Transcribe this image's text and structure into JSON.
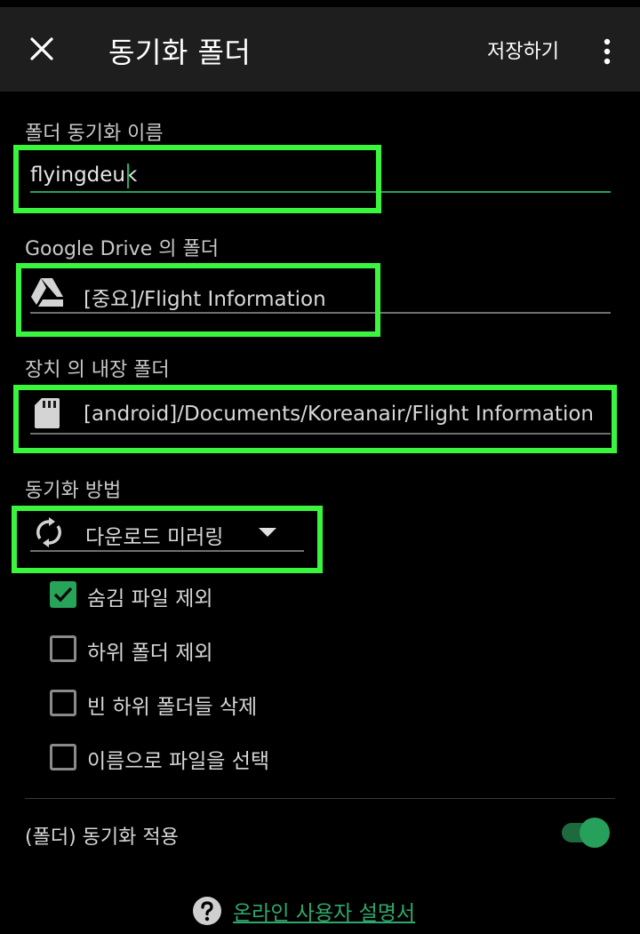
{
  "header": {
    "title": "동기화 폴더",
    "save_label": "저장하기",
    "close_icon": "close-icon",
    "more_icon": "more-vertical-icon"
  },
  "sync_name": {
    "label": "폴더 동기화 이름",
    "value": "flyingdeuk"
  },
  "remote_folder": {
    "label": "Google Drive 의 폴더",
    "value": "[중요]/Flight Information",
    "icon": "google-drive-icon"
  },
  "local_folder": {
    "label": "장치 의 내장 폴더",
    "value": "[android]/Documents/Koreanair/Flight Information",
    "icon": "sd-card-icon"
  },
  "sync_method": {
    "label": "동기화 방법",
    "selected": "다운로드 미러링",
    "icon": "sync-icon"
  },
  "options": [
    {
      "label": "숨김 파일 제외",
      "checked": true
    },
    {
      "label": "하위 폴더 제외",
      "checked": false
    },
    {
      "label": "빈 하위 폴더들 삭제",
      "checked": false
    },
    {
      "label": "이름으로 파일을 선택",
      "checked": false
    }
  ],
  "apply_sync": {
    "label": "(폴더) 동기화 적용",
    "enabled": true
  },
  "help": {
    "label": "온라인 사용자 설명서",
    "icon": "help-circle-icon"
  },
  "colors": {
    "highlight": "#39f53e",
    "accent": "#27a35a",
    "link": "#2fa86b",
    "topbar": "#1e1e1e"
  }
}
